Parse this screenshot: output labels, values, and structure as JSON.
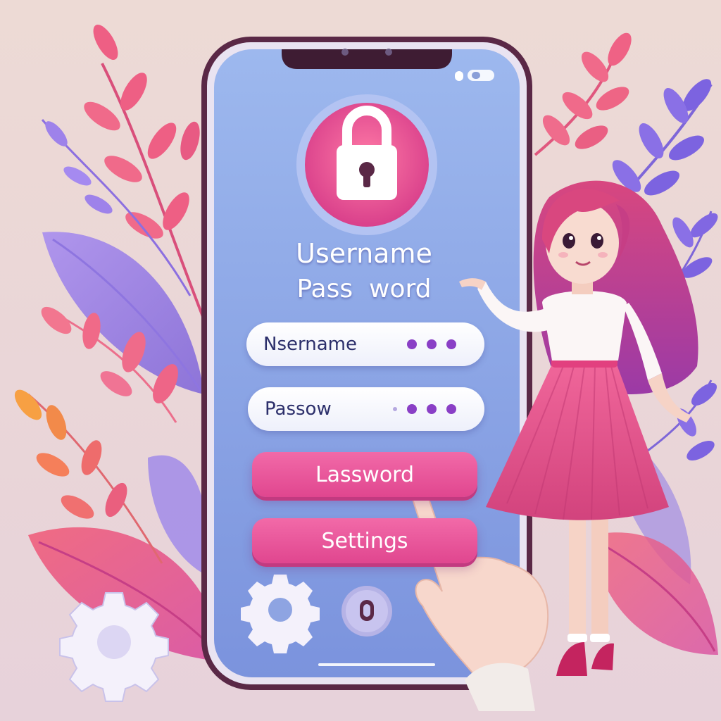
{
  "screen": {
    "title_username": "Username",
    "title_password": "Pass  word"
  },
  "form": {
    "username_field_text": "Nsername",
    "password_field_text": "Passow"
  },
  "buttons": {
    "primary_label": "Lassword",
    "settings_label": "Settings"
  },
  "icons": {
    "top": "padlock-icon",
    "bottom_left": "gear-icon",
    "bottom_center": "gear-icon",
    "bottom_right": "round-button-icon",
    "pointer": "pointing-hand-icon"
  },
  "colors": {
    "background": "#efd9d3",
    "screen_top": "#9ab5ec",
    "screen_bottom": "#7b95de",
    "accent_pink": "#ea5a9c",
    "accent_purple": "#8a3fc6",
    "phone_frame": "#5b2a47"
  }
}
